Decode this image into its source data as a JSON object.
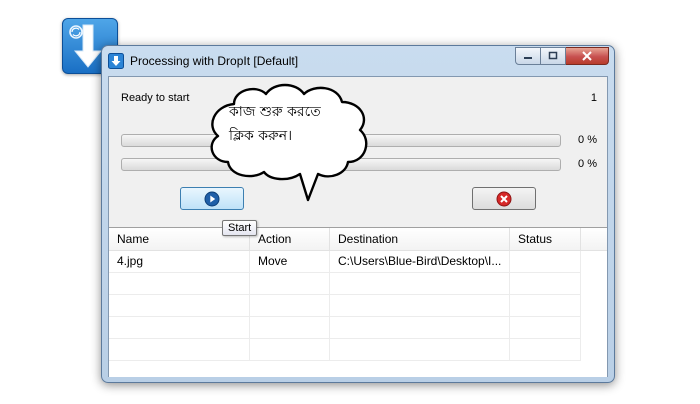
{
  "window": {
    "title": "Processing with DropIt [Default]"
  },
  "progress": {
    "status_text": "Ready to start",
    "counter": "1",
    "bar1_percent_label": "0 %",
    "bar1_value": 0,
    "bar2_percent_label": "0 %",
    "bar2_value": 0
  },
  "buttons": {
    "start_tooltip": "Start"
  },
  "list": {
    "columns": [
      "Name",
      "Action",
      "Destination",
      "Status"
    ],
    "rows": [
      {
        "name": "4.jpg",
        "action": "Move",
        "destination": "C:\\Users\\Blue-Bird\\Desktop\\I...",
        "status": ""
      }
    ]
  },
  "annotation": {
    "line1": "কাজ শুরু করতে",
    "line2": "ক্লিক করুন।"
  },
  "icons": {
    "target": "dropit-arrow-icon",
    "start": "play-icon",
    "cancel": "cancel-x-icon"
  },
  "colors": {
    "start_button": "#bfe2f8",
    "cancel_icon": "#d62828",
    "title_bar": "#c9dcef"
  }
}
